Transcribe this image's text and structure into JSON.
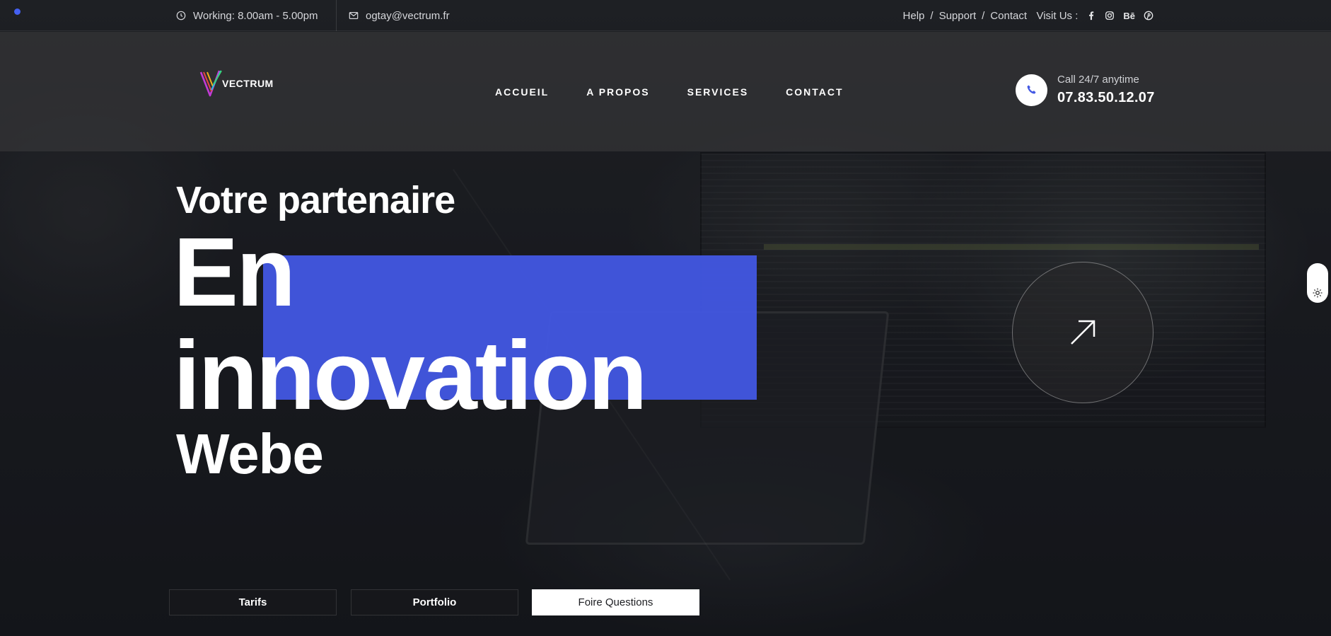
{
  "topbar": {
    "hours": "Working: 8.00am - 5.00pm",
    "email": "ogtay@vectrum.fr",
    "links": [
      "Help",
      "Support",
      "Contact"
    ],
    "link_sep": "/",
    "visit_label": "Visit Us :",
    "social_icons": [
      "facebook-icon",
      "instagram-icon",
      "behance-icon",
      "pinterest-icon"
    ],
    "behance_text": "Bē"
  },
  "header": {
    "logo_text": "VECTRUM",
    "nav": [
      "ACCUEIL",
      "A PROPOS",
      "SERVICES",
      "CONTACT"
    ],
    "call_label": "Call 24/7 anytime",
    "phone": "07.83.50.12.07"
  },
  "hero": {
    "subtitle": "Votre partenaire",
    "line1": "En",
    "line2": "innovation",
    "line3": "Webe"
  },
  "buttons": {
    "tarifs": "Tarifs",
    "portfolio": "Portfolio",
    "faq": "Foire Questions"
  },
  "colors": {
    "accent": "#4257e3",
    "dot": "#4460f1"
  }
}
